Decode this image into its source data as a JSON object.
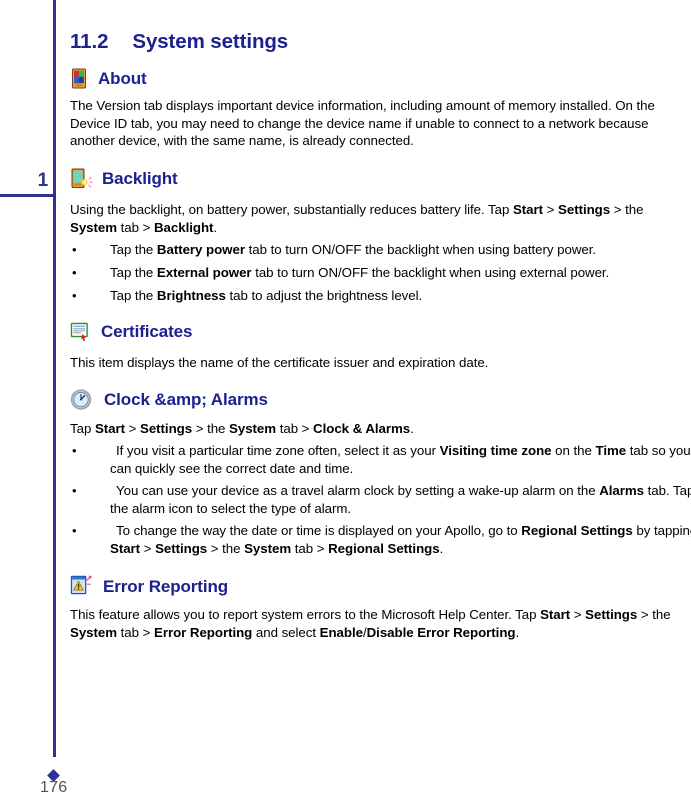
{
  "page": {
    "folio": "176",
    "tab_number": "1"
  },
  "section": {
    "number": "11.2",
    "title": "System settings"
  },
  "topics": [
    {
      "id": "about",
      "icon": "pda-device-icon",
      "heading": "About",
      "body_html": "The Version tab displays important device information, including amount of memory installed. On the Device ID tab, you may need to change the device name if unable to connect to a network because another device, with the same name, is already connected."
    },
    {
      "id": "backlight",
      "icon": "backlight-device-icon",
      "heading": "Backlight",
      "body_html": "Using the backlight, on battery power, substantially reduces battery life. Tap <b>Start</b> &gt; <b>Settings</b> &gt; the <b>System</b> tab &gt; <b>Backlight</b>.",
      "bullets": [
        "Tap the <b>Battery power</b> tab to turn ON/OFF the backlight when using battery power.",
        "Tap the <b>External power</b> tab to turn ON/OFF the backlight when using external power.",
        "Tap the <b>Brightness</b> tab to adjust the brightness level."
      ]
    },
    {
      "id": "certificates",
      "icon": "certificate-document-icon",
      "heading": "Certificates",
      "body_html": "This item displays the name of the certificate issuer and expiration date."
    },
    {
      "id": "clock-alarms",
      "icon": "clock-icon",
      "heading": "Clock &amp; Alarms",
      "body_html": "Tap <b>Start</b> &gt; <b>Settings</b> &gt; the <b>System</b> tab &gt; <b>Clock &amp; Alarms</b>.",
      "bullets": [
        "If you visit a particular time zone often, select it as your <b>Visiting time zone</b> on the <b>Time</b> tab so you can quickly see the correct date and time.",
        "You can use your device as a travel alarm clock by setting a wake-up alarm on the <b>Alarms</b> tab. Tap the alarm icon to select the type of alarm.",
        "To change the way the date or time is displayed on your Apollo, go to <b>Regional Settings</b> by tapping <b>Start</b> &gt; <b>Settings</b> &gt; the <b>System</b> tab &gt; <b>Regional Settings</b>."
      ]
    },
    {
      "id": "error-reporting",
      "icon": "error-report-icon",
      "heading": "Error Reporting",
      "body_html": "This feature allows you to report system errors to the Microsoft Help Center. Tap <b>Start</b> &gt; <b>Settings</b> &gt; the <b>System</b> tab &gt; <b>Error Reporting</b> and select <b>Enable</b>/<b>Disable Error Reporting</b>."
    }
  ],
  "colors": {
    "heading_blue": "#1b218e",
    "rule_blue": "#2e3192",
    "folio_gray": "#5b5147",
    "body_black": "#000000"
  }
}
